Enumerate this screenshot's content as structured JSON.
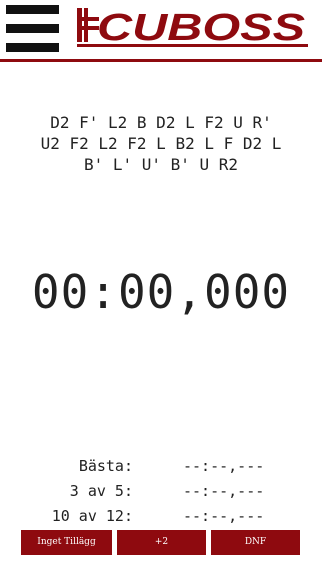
{
  "brand": {
    "logo_text": "CUBOSS",
    "accent_color": "#8e0a0f"
  },
  "scramble": {
    "lines": [
      "D2 F' L2 B D2 L F2 U R'",
      "U2 F2 L2 F2 L B2 L F D2 L",
      "B' L' U' B' U R2"
    ]
  },
  "timer": {
    "display": "00:00,000"
  },
  "stats": [
    {
      "label": "Bästa:",
      "value": "--:--,---"
    },
    {
      "label": "3 av 5:",
      "value": "--:--,---"
    },
    {
      "label": "10 av 12:",
      "value": "--:--,---"
    }
  ],
  "penalty_buttons": {
    "none_label": "Inget Tillägg",
    "plus2_label": "+2",
    "dnf_label": "DNF"
  },
  "icons": {
    "menu": "hamburger-menu-icon"
  }
}
